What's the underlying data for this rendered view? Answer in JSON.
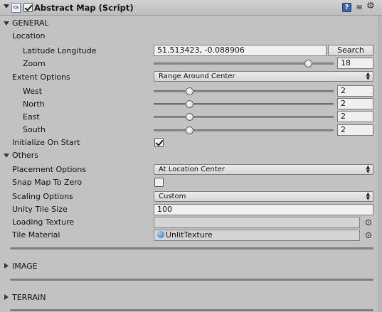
{
  "component": {
    "title": "Abstract Map (Script)",
    "script_icon_text": "cs",
    "enabled": true
  },
  "general": {
    "section_label": "GENERAL",
    "location": {
      "label": "Location",
      "latlon_label": "Latitude Longitude",
      "latlon_value": "51.513423, -0.088906",
      "search_label": "Search",
      "zoom_label": "Zoom",
      "zoom_value": "18",
      "zoom_fraction": 0.86
    },
    "extent": {
      "label": "Extent Options",
      "selected": "Range Around Center",
      "west_label": "West",
      "west_value": "2",
      "north_label": "North",
      "north_value": "2",
      "east_label": "East",
      "east_value": "2",
      "south_label": "South",
      "south_value": "2",
      "slider_fraction": 0.2
    },
    "initialize": {
      "label": "Initialize On Start",
      "checked": true
    }
  },
  "others": {
    "section_label": "Others",
    "placement_label": "Placement Options",
    "placement_selected": "At Location Center",
    "snap_label": "Snap Map To Zero",
    "snap_checked": false,
    "scaling_label": "Scaling Options",
    "scaling_selected": "Custom",
    "tile_size_label": "Unity Tile Size",
    "tile_size_value": "100",
    "loading_texture_label": "Loading Texture",
    "loading_texture_value": "",
    "tile_material_label": "Tile Material",
    "tile_material_value": "UnlitTexture"
  },
  "sections": {
    "image_label": "IMAGE",
    "terrain_label": "TERRAIN"
  },
  "icons": {
    "help": "help-icon",
    "preset": "preset-icon",
    "gear": "gear-icon",
    "picker": "object-picker-icon"
  }
}
